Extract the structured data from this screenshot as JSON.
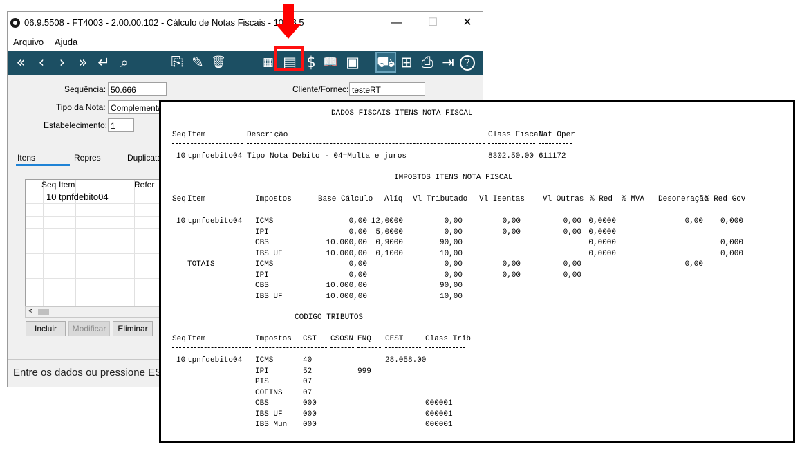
{
  "window": {
    "title": "06.9.5508 - FT4003 - 2.00.00.102 - Cálculo de Notas Fiscais - 10 - 8 5",
    "minimize": "—",
    "maximize": "☐",
    "close": "✕"
  },
  "menu": {
    "arquivo": "Arquivo",
    "ajuda": "Ajuda"
  },
  "toolbar": {
    "icons": {
      "first": "«",
      "prev": "‹",
      "next": "›",
      "last": "»",
      "enter": "↵",
      "search": "⌕",
      "new": "⎘",
      "edit": "✎",
      "delete": "🗑",
      "calc": "▦",
      "fiscal": "▤",
      "money": "$",
      "book": "📖",
      "doc": "▣",
      "truck": "⛟",
      "tree": "⊞",
      "print": "⎙",
      "exit": "⇥",
      "help": "?"
    }
  },
  "form": {
    "sequencia_label": "Sequência:",
    "sequencia_value": "50.666",
    "cliente_label": "Cliente/Fornec:",
    "cliente_value": "testeRT",
    "tipo_label": "Tipo da Nota:",
    "tipo_value": "Complementa",
    "estab_label": "Estabelecimento:",
    "estab_value": "1",
    "tabs": {
      "itens": "Itens",
      "repres": "Repres",
      "duplicata": "Duplicata"
    },
    "grid": {
      "col_seq": "Seq",
      "col_item": "Item",
      "col_refer": "Refer",
      "row_seq": "10",
      "row_item": "tpnfdebito04"
    },
    "scroll_left": "<",
    "buttons": {
      "incluir": "Incluir",
      "modificar": "Modificar",
      "eliminar": "Eliminar"
    },
    "status": "Entre os dados ou pressione ES"
  },
  "report": {
    "title1": "DADOS FISCAIS ITENS NOTA FISCAL",
    "h1": {
      "seq": "Seq",
      "item": "Item",
      "descricao": "Descrição",
      "class_fiscal": "Class Fiscal",
      "nat_oper": "Nat Oper"
    },
    "r1": {
      "seq": "10",
      "item": "tpnfdebito04",
      "descricao": "Tipo Nota Debito - 04=Multa e juros",
      "class_fiscal": "8302.50.00",
      "nat_oper": "611172"
    },
    "title2": "IMPOSTOS ITENS NOTA FISCAL",
    "h2": {
      "seq": "Seq",
      "item": "Item",
      "impostos": "Impostos",
      "base": "Base Cálculo",
      "aliq": "Alíq",
      "vl_trib": "Vl Tributado",
      "vl_isentas": "Vl Isentas",
      "vl_outras": "Vl Outras",
      "red": "% Red",
      "mva": "% MVA",
      "desoneracao": "Desoneração",
      "red_gov": "% Red Gov"
    },
    "imp_seq": "10",
    "imp_item": "tpnfdebito04",
    "imp_rows": [
      {
        "imposto": "ICMS",
        "base": "0,00",
        "aliq": "12,0000",
        "trib": "0,00",
        "isentas": "0,00",
        "outras": "0,00",
        "red": "0,0000",
        "deson": "0,00",
        "redgov": "0,000"
      },
      {
        "imposto": "IPI",
        "base": "0,00",
        "aliq": "5,0000",
        "trib": "0,00",
        "isentas": "0,00",
        "outras": "0,00",
        "red": "0,0000",
        "deson": "",
        "redgov": ""
      },
      {
        "imposto": "CBS",
        "base": "10.000,00",
        "aliq": "0,9000",
        "trib": "90,00",
        "isentas": "",
        "outras": "",
        "red": "0,0000",
        "deson": "",
        "redgov": "0,000"
      },
      {
        "imposto": "IBS UF",
        "base": "10.000,00",
        "aliq": "0,1000",
        "trib": "10,00",
        "isentas": "",
        "outras": "",
        "red": "0,0000",
        "deson": "",
        "redgov": "0,000"
      }
    ],
    "totais_label": "TOTAIS",
    "tot_rows": [
      {
        "imposto": "ICMS",
        "base": "0,00",
        "trib": "0,00",
        "isentas": "0,00",
        "outras": "0,00",
        "deson": "0,00"
      },
      {
        "imposto": "IPI",
        "base": "0,00",
        "trib": "0,00",
        "isentas": "0,00",
        "outras": "0,00",
        "deson": ""
      },
      {
        "imposto": "CBS",
        "base": "10.000,00",
        "trib": "90,00",
        "isentas": "",
        "outras": "",
        "deson": ""
      },
      {
        "imposto": "IBS UF",
        "base": "10.000,00",
        "trib": "10,00",
        "isentas": "",
        "outras": "",
        "deson": ""
      }
    ],
    "title3": "CODIGO TRIBUTOS",
    "h3": {
      "seq": "Seq",
      "item": "Item",
      "impostos": "Impostos",
      "cst": "CST",
      "csosn": "CSOSN",
      "enq": "ENQ",
      "cest": "CEST",
      "class_trib": "Class Trib"
    },
    "cod_seq": "10",
    "cod_item": "tpnfdebito04",
    "cod_rows": [
      {
        "imposto": "ICMS",
        "cst": "40",
        "enq": "",
        "cest": "28.058.00",
        "class_trib": ""
      },
      {
        "imposto": "IPI",
        "cst": "52",
        "enq": "999",
        "cest": "",
        "class_trib": ""
      },
      {
        "imposto": "PIS",
        "cst": "07",
        "enq": "",
        "cest": "",
        "class_trib": ""
      },
      {
        "imposto": "COFINS",
        "cst": "07",
        "enq": "",
        "cest": "",
        "class_trib": ""
      },
      {
        "imposto": "CBS",
        "cst": "000",
        "enq": "",
        "cest": "",
        "class_trib": "000001"
      },
      {
        "imposto": "IBS UF",
        "cst": "000",
        "enq": "",
        "cest": "",
        "class_trib": "000001"
      },
      {
        "imposto": "IBS Mun",
        "cst": "000",
        "enq": "",
        "cest": "",
        "class_trib": "000001"
      }
    ]
  },
  "colors": {
    "toolbar": "#1c4f63",
    "highlight": "#ff0000",
    "tab_underline": "#1f83d6"
  }
}
